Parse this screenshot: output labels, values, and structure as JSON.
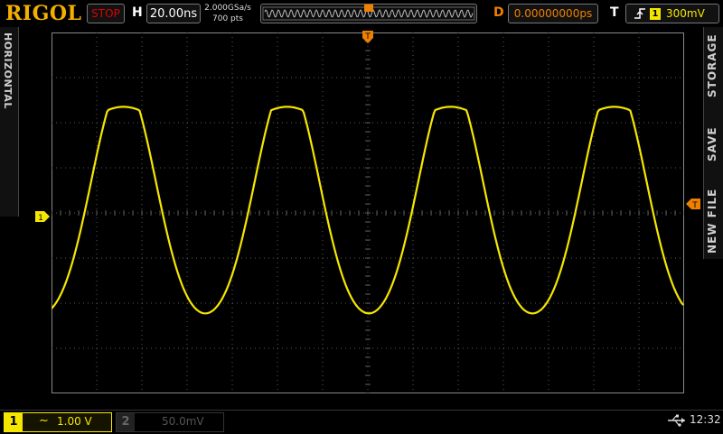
{
  "brand": "RIGOL",
  "run_state": "STOP",
  "horizontal": {
    "label": "H",
    "timebase": "20.00ns",
    "sample_rate": "2.000GSa/s",
    "points": "700  pts",
    "delay_label": "D",
    "delay": "0.00000000ps"
  },
  "trigger": {
    "label": "T",
    "source": "1",
    "level": "300mV",
    "marker": "T"
  },
  "left_menu": {
    "tab": "HORIZONTAL"
  },
  "side_menu": {
    "items": [
      "STORAGE",
      "SAVE",
      "NEW FILE"
    ]
  },
  "channels": [
    {
      "number": "1",
      "coupling": "~",
      "scale": "1.00 V",
      "active": true,
      "color": "#f5e600"
    },
    {
      "number": "2",
      "scale": "50.0mV",
      "active": false,
      "color": "#555555"
    }
  ],
  "marker_ch1": "1",
  "clock": "12:32",
  "colors": {
    "trace": "#f5e600",
    "trigger": "#f08000",
    "grid": "#5a5a5a"
  }
}
